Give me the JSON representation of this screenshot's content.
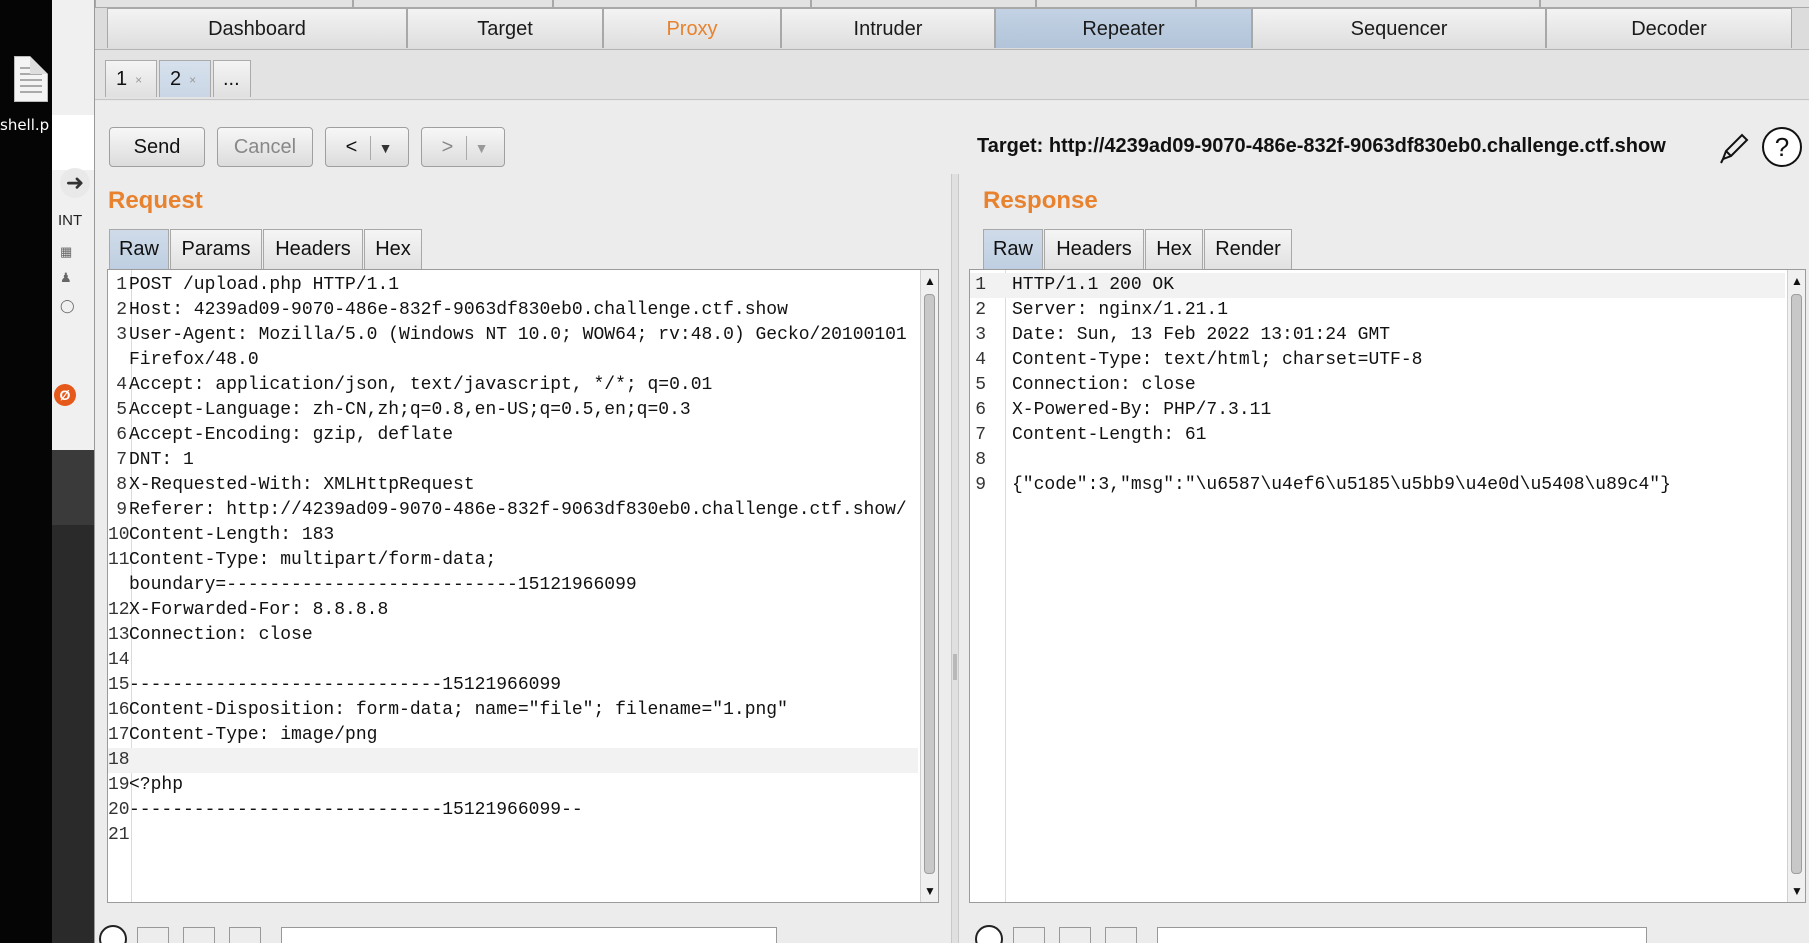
{
  "desktop": {
    "file_label": "shell.p",
    "browser_side": {
      "int_label": "INT",
      "badge": "Ø"
    }
  },
  "burp": {
    "top_tabs": [
      "Dashboard",
      "Target",
      "Proxy",
      "Intruder",
      "Repeater",
      "Sequencer",
      "Decoder"
    ],
    "active_top_tab": "Repeater",
    "sub_tabs": [
      {
        "label": "1",
        "close": "×"
      },
      {
        "label": "2",
        "close": "×"
      },
      {
        "label": "...",
        "close": ""
      }
    ],
    "toolbar": {
      "send_label": "Send",
      "cancel_label": "Cancel",
      "back_label": "<",
      "forward_label": ">",
      "dropdown_glyph": "▼",
      "target_text": "Target: http://4239ad09-9070-486e-832f-9063df830eb0.challenge.ctf.show",
      "help_label": "?"
    },
    "request": {
      "title": "Request",
      "tabs": [
        "Raw",
        "Params",
        "Headers",
        "Hex"
      ],
      "lines": [
        {
          "n": "1",
          "t": "POST /upload.php HTTP/1.1"
        },
        {
          "n": "2",
          "t": "Host: 4239ad09-9070-486e-832f-9063df830eb0.challenge.ctf.show"
        },
        {
          "n": "3",
          "t": "User-Agent: Mozilla/5.0 (Windows NT 10.0; WOW64; rv:48.0) Gecko/20100101"
        },
        {
          "n": "",
          "t": "Firefox/48.0"
        },
        {
          "n": "4",
          "t": "Accept: application/json, text/javascript, */*; q=0.01"
        },
        {
          "n": "5",
          "t": "Accept-Language: zh-CN,zh;q=0.8,en-US;q=0.5,en;q=0.3"
        },
        {
          "n": "6",
          "t": "Accept-Encoding: gzip, deflate"
        },
        {
          "n": "7",
          "t": "DNT: 1"
        },
        {
          "n": "8",
          "t": "X-Requested-With: XMLHttpRequest"
        },
        {
          "n": "9",
          "t": "Referer: http://4239ad09-9070-486e-832f-9063df830eb0.challenge.ctf.show/"
        },
        {
          "n": "10",
          "t": "Content-Length: 183"
        },
        {
          "n": "11",
          "t": "Content-Type: multipart/form-data;"
        },
        {
          "n": "",
          "t": "boundary=---------------------------15121966099"
        },
        {
          "n": "12",
          "t": "X-Forwarded-For: 8.8.8.8"
        },
        {
          "n": "13",
          "t": "Connection: close"
        },
        {
          "n": "14",
          "t": ""
        },
        {
          "n": "15",
          "t": "-----------------------------15121966099"
        },
        {
          "n": "16",
          "t": "Content-Disposition: form-data; name=\"file\"; filename=\"1.png\""
        },
        {
          "n": "17",
          "t": "Content-Type: image/png"
        },
        {
          "n": "18",
          "t": ""
        },
        {
          "n": "19",
          "t": "<?php"
        },
        {
          "n": "20",
          "t": "-----------------------------15121966099--"
        },
        {
          "n": "21",
          "t": ""
        }
      ]
    },
    "response": {
      "title": "Response",
      "tabs": [
        "Raw",
        "Headers",
        "Hex",
        "Render"
      ],
      "lines": [
        {
          "n": "1",
          "t": "HTTP/1.1 200 OK"
        },
        {
          "n": "2",
          "t": "Server: nginx/1.21.1"
        },
        {
          "n": "3",
          "t": "Date: Sun, 13 Feb 2022 13:01:24 GMT"
        },
        {
          "n": "4",
          "t": "Content-Type: text/html; charset=UTF-8"
        },
        {
          "n": "5",
          "t": "Connection: close"
        },
        {
          "n": "6",
          "t": "X-Powered-By: PHP/7.3.11"
        },
        {
          "n": "7",
          "t": "Content-Length: 61"
        },
        {
          "n": "8",
          "t": ""
        },
        {
          "n": "9",
          "t": "{\"code\":3,\"msg\":\"\\u6587\\u4ef6\\u5185\\u5bb9\\u4e0d\\u5408\\u89c4\"}"
        }
      ]
    }
  }
}
